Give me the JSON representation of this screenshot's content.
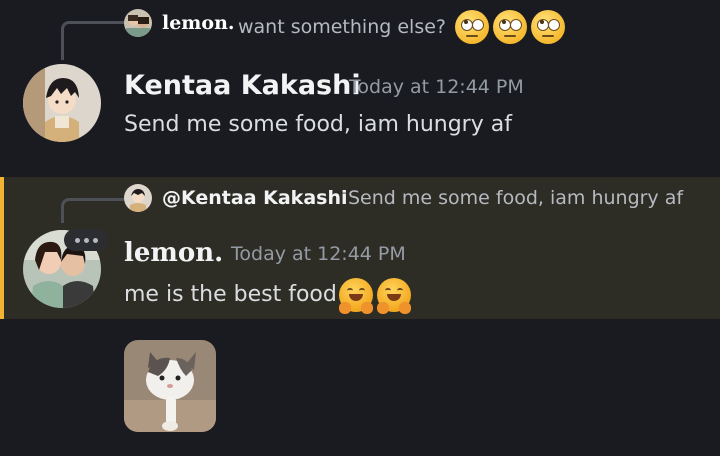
{
  "messages": [
    {
      "reply": {
        "author": "lemon.",
        "text": "want something else?"
      },
      "author": "Kentaa Kakashi",
      "timestamp": "Today at 12:44 PM",
      "content": "Send me some food, iam hungry af"
    },
    {
      "reply": {
        "author": "@Kentaa Kakashi",
        "text": "Send me some food, iam hungry af"
      },
      "author": "lemon.",
      "timestamp": "Today at 12:44 PM",
      "content": "me is the best food",
      "highlighted": true
    }
  ],
  "colors": {
    "background": "#1a1b21",
    "highlight": "#2e2d25",
    "mention_bar": "#f0b232",
    "username": "#f2f3f5",
    "muted": "#949ba4"
  },
  "icons": [
    "avatar",
    "rolling-eyes-emoji",
    "hugging-face-emoji",
    "typing-indicator-icon",
    "cat-gif-attachment"
  ]
}
